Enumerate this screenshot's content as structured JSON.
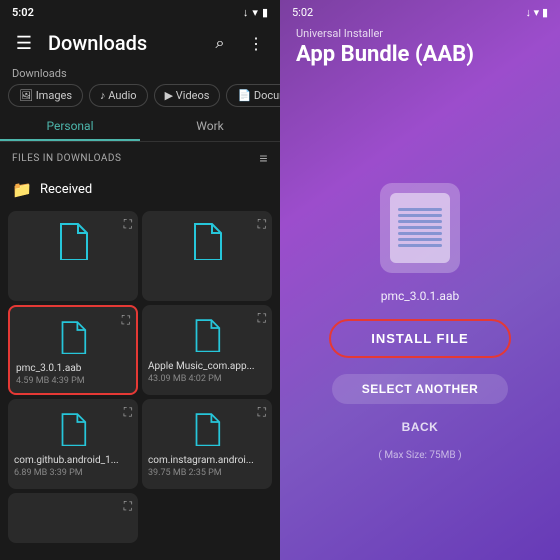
{
  "left": {
    "status_bar": {
      "time": "5:02",
      "download_icon": "↓",
      "wifi_icon": "▾",
      "signal_icon": "▮"
    },
    "header": {
      "menu_icon": "☰",
      "title": "Downloads",
      "search_icon": "⌕",
      "more_icon": "⋮"
    },
    "filter_bar": {
      "label": "Downloads",
      "chips": [
        {
          "label": "🖼 Images",
          "active": false
        },
        {
          "label": "♪ Audio",
          "active": false
        },
        {
          "label": "▶ Videos",
          "active": false
        },
        {
          "label": "📄 Documents",
          "active": false
        }
      ]
    },
    "tabs": [
      {
        "label": "Personal",
        "active": true
      },
      {
        "label": "Work",
        "active": false
      }
    ],
    "section_header": "FILES IN DOWNLOADS",
    "folder": {
      "name": "Received"
    },
    "files": [
      {
        "name": "pmc_3.0.1.aab",
        "meta": "4.59 MB 4:39 PM",
        "highlighted": true,
        "row": 0
      },
      {
        "name": "Apple Music_com.app...",
        "meta": "43.09 MB 4:02 PM",
        "highlighted": false,
        "row": 0
      },
      {
        "name": "com.github.android_1...",
        "meta": "6.89 MB 3:39 PM",
        "highlighted": false,
        "row": 1
      },
      {
        "name": "com.instagram.androi...",
        "meta": "39.75 MB 2:35 PM",
        "highlighted": false,
        "row": 1
      }
    ]
  },
  "right": {
    "status_bar": {
      "time": "5:02",
      "download_icon": "↓",
      "wifi_icon": "▾",
      "signal_icon": "▮"
    },
    "header_label": "Universal Installer",
    "header_title": "App Bundle (AAB)",
    "file_name": "pmc_3.0.1.aab",
    "install_button": "INSTALL FILE",
    "select_another_button": "SELECT ANOTHER",
    "back_button": "BACK",
    "max_size": "( Max Size: 75MB )"
  }
}
